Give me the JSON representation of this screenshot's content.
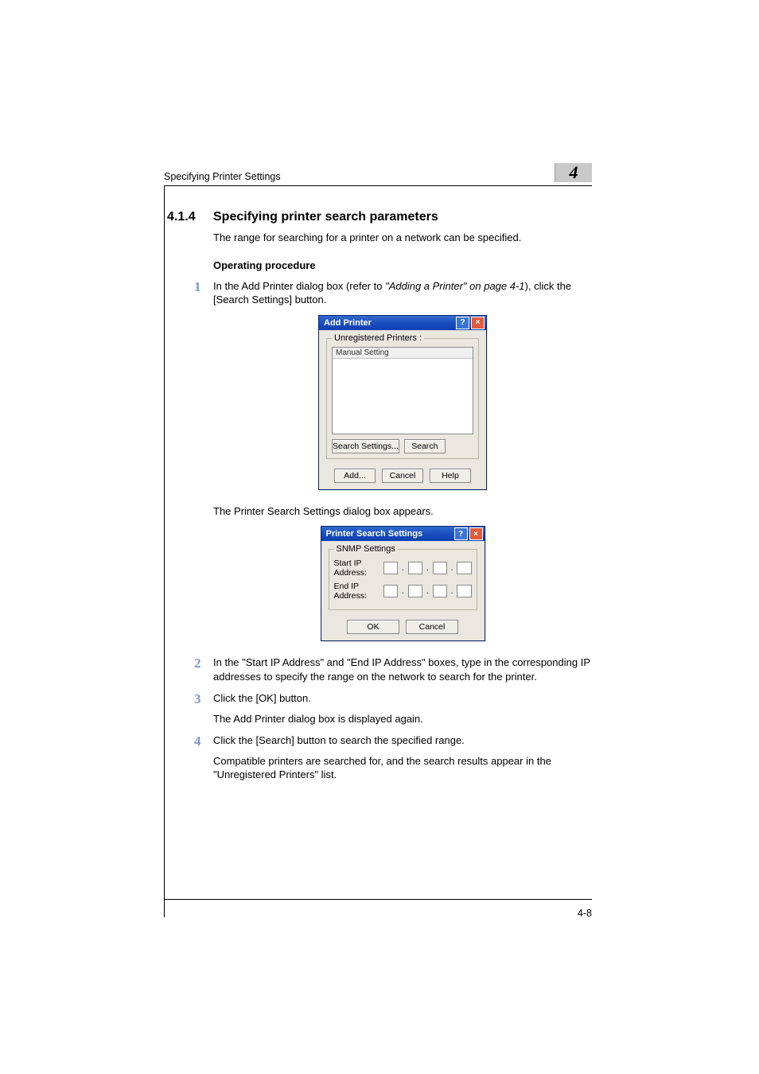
{
  "running_head": "Specifying Printer Settings",
  "chapter_number": "4",
  "section": {
    "number": "4.1.4",
    "title": "Specifying printer search parameters",
    "intro": "The range for searching for a printer on a network can be specified."
  },
  "procedure_heading": "Operating procedure",
  "steps": [
    {
      "num": "1",
      "pre": "In the Add Printer dialog box (refer to ",
      "ref": "\"Adding a Printer\" on page 4-1",
      "post": "), click the [Search Settings] button.",
      "result": "The Printer Search Settings dialog box appears."
    },
    {
      "num": "2",
      "text": "In the \"Start IP Address\" and \"End IP Address\" boxes, type in the corresponding IP addresses to specify the range on the network to search for the printer."
    },
    {
      "num": "3",
      "text": "Click the [OK] button.",
      "result": "The Add Printer dialog box is displayed again."
    },
    {
      "num": "4",
      "text": "Click the [Search] button to search the specified range.",
      "result": "Compatible printers are searched for, and the search results appear in the \"Unregistered Printers\" list."
    }
  ],
  "add_printer_dialog": {
    "title": "Add Printer",
    "help_glyph": "?",
    "close_glyph": "×",
    "group_label": "Unregistered Printers :",
    "list_header": "Manual Setting",
    "search_settings_btn": "Search Settings...",
    "search_btn": "Search",
    "add_btn": "Add...",
    "cancel_btn": "Cancel",
    "help_btn": "Help"
  },
  "search_settings_dialog": {
    "title": "Printer Search Settings",
    "help_glyph": "?",
    "close_glyph": "×",
    "group_label": "SNMP Settings",
    "start_ip_label": "Start IP Address:",
    "end_ip_label": "End IP Address:",
    "ok_btn": "OK",
    "cancel_btn": "Cancel"
  },
  "footer_page": "4-8"
}
